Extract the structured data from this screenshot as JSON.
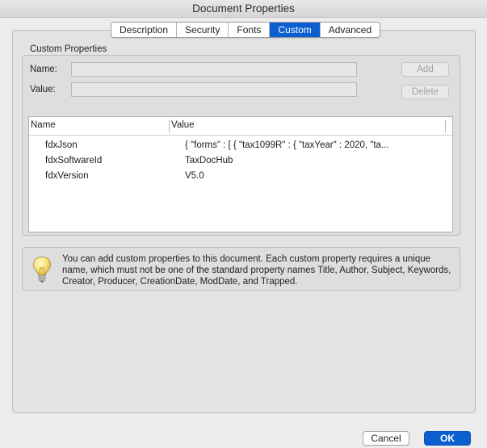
{
  "window": {
    "title": "Document Properties"
  },
  "tabs": [
    {
      "label": "Description",
      "active": false
    },
    {
      "label": "Security",
      "active": false
    },
    {
      "label": "Fonts",
      "active": false
    },
    {
      "label": "Custom",
      "active": true
    },
    {
      "label": "Advanced",
      "active": false
    }
  ],
  "custom": {
    "group_title": "Custom Properties",
    "name_label": "Name:",
    "name_value": "",
    "value_label": "Value:",
    "value_value": "",
    "add_label": "Add",
    "delete_label": "Delete",
    "table": {
      "columns": [
        "Name",
        "Value"
      ],
      "rows": [
        {
          "name": "fdxJson",
          "value": "{   \"forms\" : [ {     \"tax1099R\" : {       \"taxYear\" : 2020,       \"ta..."
        },
        {
          "name": "fdxSoftwareId",
          "value": "TaxDocHub"
        },
        {
          "name": "fdxVersion",
          "value": "V5.0"
        }
      ]
    }
  },
  "info": {
    "icon": "lightbulb-icon",
    "text": "You can add custom properties to this document. Each custom property requires a unique name, which must not be one of the standard property names Title, Author, Subject, Keywords, Creator, Producer, CreationDate, ModDate, and Trapped."
  },
  "buttons": {
    "cancel": "Cancel",
    "ok": "OK"
  },
  "colors": {
    "accent": "#0b5fd0"
  }
}
